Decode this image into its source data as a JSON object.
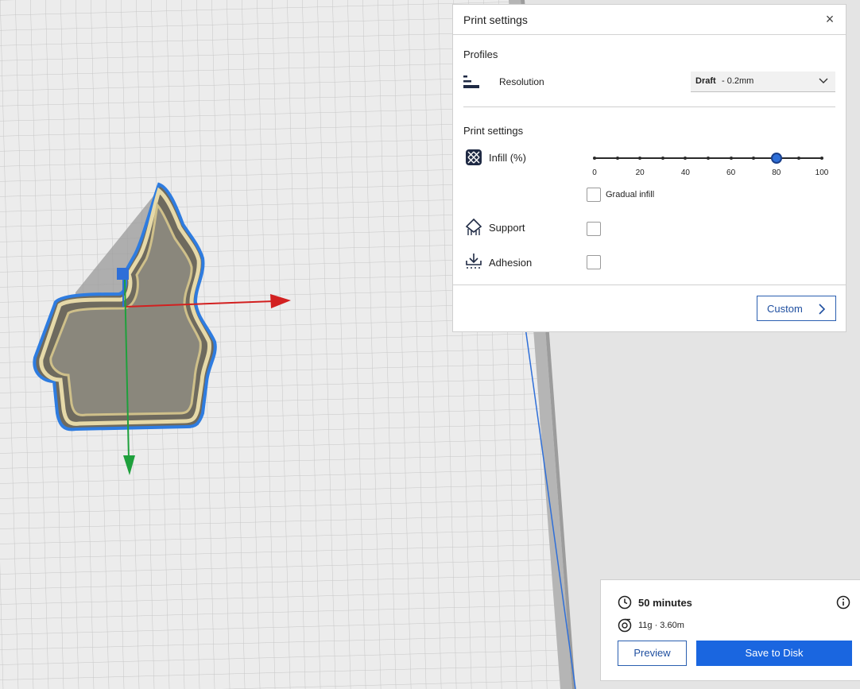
{
  "print_settings": {
    "title": "Print settings",
    "close_glyph": "×",
    "profiles_heading": "Profiles",
    "resolution": {
      "icon": "resolution-icon",
      "label": "Resolution",
      "value_bold": "Draft",
      "value_rest": "- 0.2mm"
    },
    "settings_heading": "Print settings",
    "infill": {
      "icon": "infill-icon",
      "label": "Infill (%)",
      "value": 80,
      "min": 0,
      "max": 100,
      "tick_labels": [
        "0",
        "20",
        "40",
        "60",
        "80",
        "100"
      ],
      "gradual_label": "Gradual infill",
      "gradual_checked": false
    },
    "support": {
      "icon": "support-icon",
      "label": "Support",
      "checked": false
    },
    "adhesion": {
      "icon": "adhesion-icon",
      "label": "Adhesion",
      "checked": false
    },
    "custom_label": "Custom"
  },
  "summary": {
    "time": "50 minutes",
    "material": "11g · 3.60m",
    "preview_label": "Preview",
    "save_label": "Save to Disk",
    "accent": "#1a66e0"
  },
  "viewport": {
    "model": "cookie-cutter-model",
    "axes": {
      "x_color": "#d22020",
      "y_color": "#1ea03c",
      "z_color": "#2e6fd8"
    }
  }
}
